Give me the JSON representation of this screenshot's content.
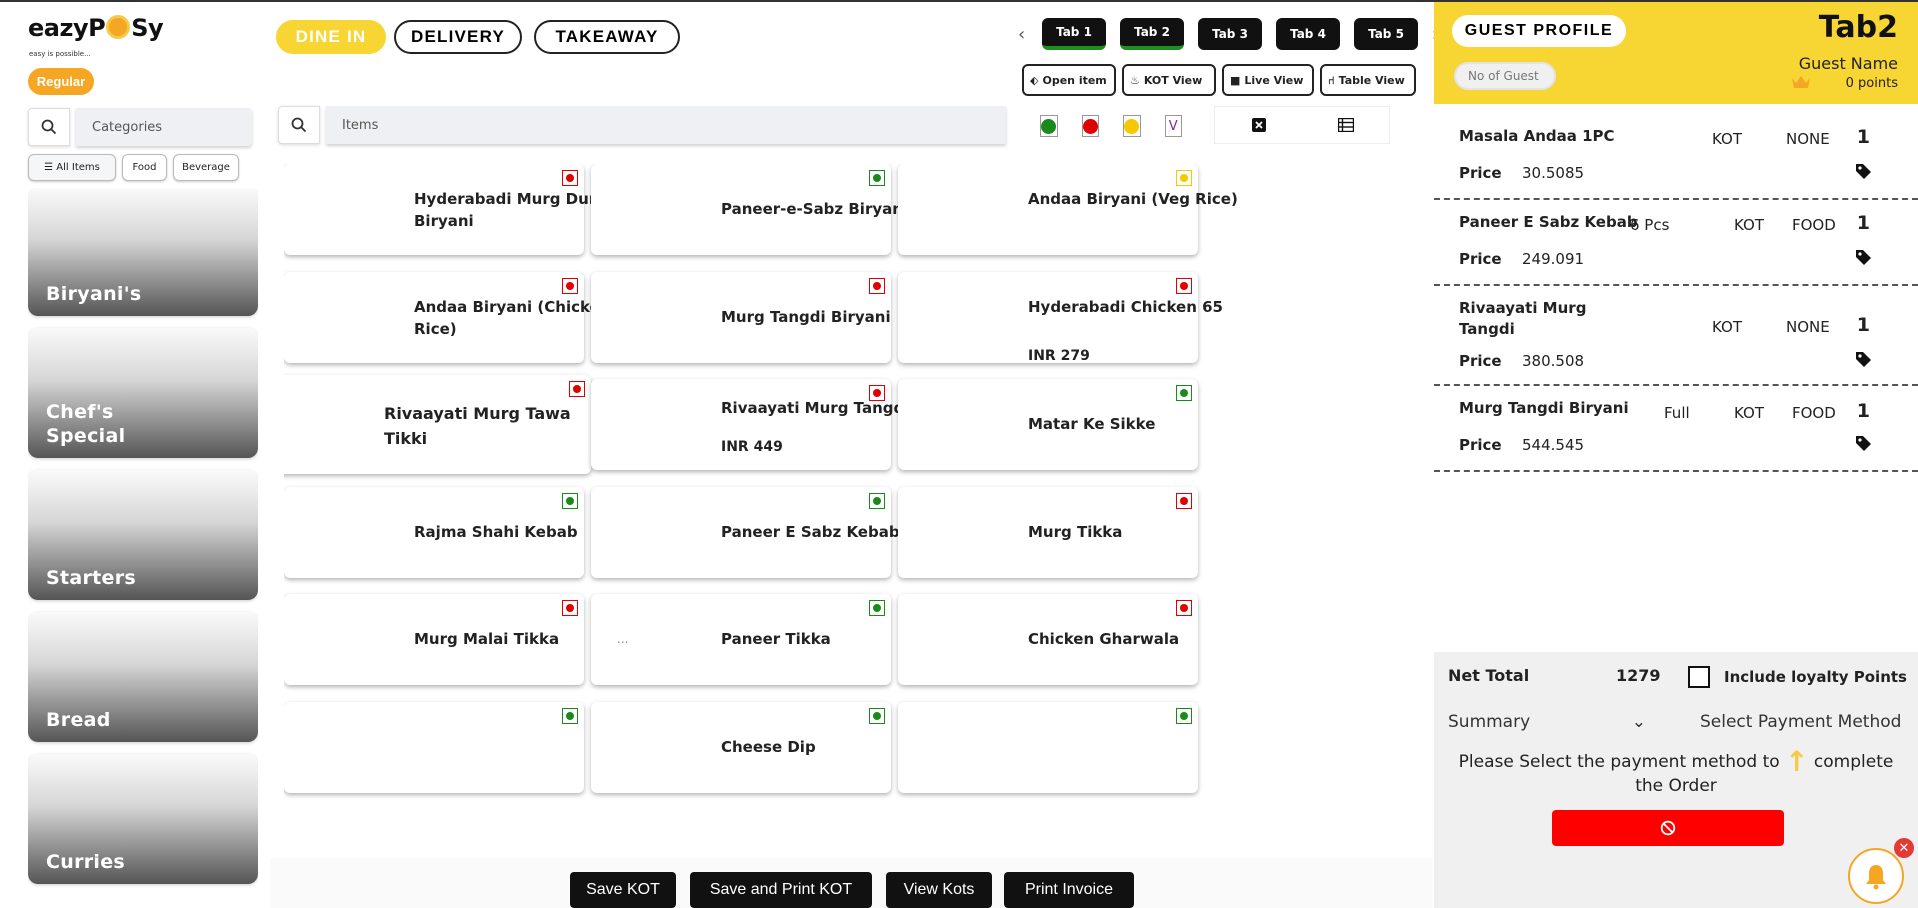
{
  "brand": {
    "logo_text_left": "eazyP",
    "logo_text_right": "Sy",
    "tagline": "easy is possible..."
  },
  "mode_badge": "Regular",
  "category_search": {
    "placeholder": "Categories"
  },
  "filters": {
    "all": "All Items",
    "food": "Food",
    "beverage": "Beverage"
  },
  "categories": [
    "Biryani's",
    "Chef's Special",
    "Starters",
    "Bread",
    "Curries"
  ],
  "order_types": {
    "dine_in": "DINE IN",
    "delivery": "DELIVERY",
    "takeaway": "TAKEAWAY",
    "active": "dine_in"
  },
  "tabs": [
    "Tab 1",
    "Tab 2",
    "Tab 3",
    "Tab 4",
    "Tab 5"
  ],
  "views": {
    "open_item": "Open item",
    "kot_view": "KOT View",
    "live_view": "Live View",
    "table_view": "Table View"
  },
  "item_search": {
    "placeholder": "Items"
  },
  "type_filters": {
    "veg_color": "#1a8a1a",
    "nonveg_color": "#e00000",
    "egg_color": "#f5c800",
    "vegan_label": "V"
  },
  "items": [
    {
      "name": "Hyderabadi Murg Dum Biryani",
      "type": "nonveg",
      "price": ""
    },
    {
      "name": "Paneer-e-Sabz Biryani",
      "type": "veg",
      "price": ""
    },
    {
      "name": "Andaa Biryani (Veg Rice)",
      "type": "egg",
      "price": ""
    },
    {
      "name": "Andaa Biryani (Chicken Rice)",
      "type": "nonveg",
      "price": ""
    },
    {
      "name": "Murg Tangdi Biryani",
      "type": "nonveg",
      "price": ""
    },
    {
      "name": "Hyderabadi Chicken 65",
      "type": "nonveg",
      "price": "INR 279"
    },
    {
      "name": "Rivaayati Murg Tawa Tikki",
      "type": "nonveg",
      "price": ""
    },
    {
      "name": "Rivaayati Murg Tangdi",
      "type": "nonveg",
      "price": "INR 449"
    },
    {
      "name": "Matar Ke Sikke",
      "type": "veg",
      "price": ""
    },
    {
      "name": "Rajma Shahi Kebab",
      "type": "veg",
      "price": ""
    },
    {
      "name": "Paneer E Sabz Kebab",
      "type": "veg",
      "price": ""
    },
    {
      "name": "Murg Tikka",
      "type": "nonveg",
      "price": ""
    },
    {
      "name": "Murg Malai Tikka",
      "type": "nonveg",
      "price": ""
    },
    {
      "name": "Paneer Tikka",
      "type": "veg",
      "price": "",
      "img_alt": "..."
    },
    {
      "name": "Chicken Gharwala",
      "type": "nonveg",
      "price": ""
    },
    {
      "name": "",
      "type": "veg",
      "price": ""
    },
    {
      "name": "Cheese Dip",
      "type": "veg",
      "price": ""
    },
    {
      "name": "",
      "type": "veg",
      "price": ""
    }
  ],
  "actions": {
    "save_kot": "Save KOT",
    "save_print_kot": "Save and Print KOT",
    "view_kots": "View Kots",
    "print_invoice": "Print Invoice"
  },
  "guest": {
    "title": "GUEST PROFILE",
    "tab": "Tab2",
    "no_of_guest_placeholder": "No of Guest",
    "name_label": "Guest Name",
    "points": "0 points"
  },
  "order_items": [
    {
      "name": "Masala Andaa 1PC",
      "variant": "",
      "kot": "KOT",
      "category": "NONE",
      "qty": "1",
      "price_label": "Price",
      "price": "30.5085"
    },
    {
      "name": "Paneer E Sabz Kebab",
      "variant": "6 Pcs",
      "kot": "KOT",
      "category": "FOOD",
      "qty": "1",
      "price_label": "Price",
      "price": "249.091"
    },
    {
      "name": "Rivaayati Murg Tangdi",
      "variant": "",
      "kot": "KOT",
      "category": "NONE",
      "qty": "1",
      "price_label": "Price",
      "price": "380.508"
    },
    {
      "name": "Murg Tangdi Biryani",
      "variant": "Full",
      "kot": "KOT",
      "category": "FOOD",
      "qty": "1",
      "price_label": "Price",
      "price": "544.545"
    }
  ],
  "totals": {
    "net_label": "Net Total",
    "net_value": "1279",
    "loyalty_label": "Include loyalty Points"
  },
  "summary_select": "Summary",
  "payment_method": "Select Payment Method",
  "payment_message_a": "Please Select the payment method to",
  "payment_message_b": "complete the Order"
}
